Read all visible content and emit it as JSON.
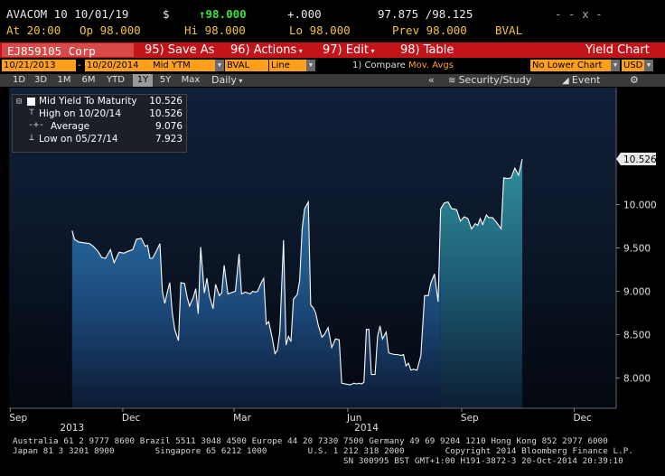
{
  "quote": {
    "security": "AVACOM 10 10/01/19",
    "currency_symbol": "$",
    "last": "98.000",
    "change": "+.000",
    "bid_ask": "97.875 /98.125",
    "window_controls": "- - x -",
    "at_label": "At",
    "at_value": "20:00",
    "open_label": "Op",
    "open_value": "98.000",
    "high_label": "Hi",
    "high_value": "98.000",
    "low_label": "Lo",
    "low_value": "98.000",
    "prev_label": "Prev",
    "prev_value": "98.000",
    "source": "BVAL"
  },
  "toolbar": {
    "ticker": "EJ859105 Corp",
    "save_label": "95) Save As",
    "actions_label": "96) Actions",
    "edit_label": "97) Edit",
    "table_label": "98) Table",
    "title": "Yield Chart"
  },
  "settings": {
    "start_date": "10/21/2013",
    "end_date": "10/20/2014",
    "field": "Mid YTM",
    "source": "BVAL",
    "style": "Line",
    "compare_label": "1) Compare",
    "mov_avgs": "Mov. Avgs",
    "lower_chart": "No Lower Chart",
    "currency": "USD"
  },
  "periods": {
    "items": [
      "1D",
      "3D",
      "1M",
      "6M",
      "YTD",
      "1Y",
      "5Y",
      "Max"
    ],
    "selected": "1Y",
    "frequency": "Daily",
    "security_study": "Security/Study",
    "event": "Event"
  },
  "legend": {
    "series": "Mid Yield To Maturity",
    "series_value": "10.526",
    "high_label": "High on 10/20/14",
    "high_value": "10.526",
    "avg_label": "Average",
    "avg_value": "9.076",
    "low_label": "Low on 05/27/14",
    "low_value": "7.923"
  },
  "chart_data": {
    "type": "area",
    "series": [
      {
        "name": "Mid Yield To Maturity",
        "x": [
          "2013-10-21",
          "2013-10-23",
          "2013-10-26",
          "2013-10-30",
          "2013-11-04",
          "2013-11-07",
          "2013-11-11",
          "2013-11-14",
          "2013-11-17",
          "2013-11-21",
          "2013-11-24",
          "2013-11-28",
          "2013-12-02",
          "2013-12-05",
          "2013-12-09",
          "2013-12-12",
          "2013-12-16",
          "2013-12-19",
          "2013-12-21",
          "2013-12-23",
          "2013-12-25",
          "2013-12-28",
          "2013-12-31",
          "2014-01-02",
          "2014-01-04",
          "2014-01-06",
          "2014-01-08",
          "2014-01-10",
          "2014-01-12",
          "2014-01-15",
          "2014-01-17",
          "2014-01-20",
          "2014-01-22",
          "2014-01-24",
          "2014-01-27",
          "2014-01-29",
          "2014-01-31",
          "2014-02-02",
          "2014-02-05",
          "2014-02-07",
          "2014-02-09",
          "2014-02-12",
          "2014-02-14",
          "2014-02-17",
          "2014-02-19",
          "2014-02-21",
          "2014-02-24",
          "2014-02-26",
          "2014-02-28",
          "2014-03-02",
          "2014-03-05",
          "2014-03-07",
          "2014-03-10",
          "2014-03-12",
          "2014-03-14",
          "2014-03-16",
          "2014-03-18",
          "2014-03-20",
          "2014-03-23",
          "2014-03-25",
          "2014-03-27",
          "2014-03-29",
          "2014-04-01",
          "2014-04-03",
          "2014-04-05",
          "2014-04-07",
          "2014-04-10",
          "2014-04-12",
          "2014-04-14",
          "2014-04-16",
          "2014-04-18",
          "2014-04-21",
          "2014-04-23",
          "2014-04-25",
          "2014-04-27",
          "2014-04-30",
          "2014-05-02",
          "2014-05-04",
          "2014-05-06",
          "2014-05-08",
          "2014-05-11",
          "2014-05-13",
          "2014-05-16",
          "2014-05-19",
          "2014-05-22",
          "2014-05-25",
          "2014-05-27",
          "2014-05-30",
          "2014-06-03",
          "2014-06-06",
          "2014-06-08",
          "2014-06-10",
          "2014-06-12",
          "2014-06-14",
          "2014-06-16",
          "2014-06-18",
          "2014-06-20",
          "2014-06-23",
          "2014-06-25",
          "2014-06-27",
          "2014-06-29",
          "2014-07-02",
          "2014-07-04",
          "2014-07-06",
          "2014-07-09",
          "2014-07-11",
          "2014-07-14",
          "2014-07-16",
          "2014-07-18",
          "2014-07-20",
          "2014-07-22",
          "2014-07-24",
          "2014-07-27",
          "2014-07-30",
          "2014-08-02",
          "2014-08-05",
          "2014-08-07",
          "2014-08-10",
          "2014-08-13",
          "2014-08-15",
          "2014-08-18",
          "2014-08-21",
          "2014-08-24",
          "2014-08-26",
          "2014-08-28",
          "2014-08-31",
          "2014-09-03",
          "2014-09-06",
          "2014-09-09",
          "2014-09-12",
          "2014-09-14",
          "2014-09-16",
          "2014-09-18",
          "2014-09-21",
          "2014-09-23",
          "2014-09-26",
          "2014-09-29",
          "2014-10-01",
          "2014-10-03",
          "2014-10-05",
          "2014-10-08",
          "2014-10-11",
          "2014-10-14",
          "2014-10-17",
          "2014-10-20"
        ],
        "y": [
          9.7,
          9.6,
          9.57,
          9.56,
          9.55,
          9.52,
          9.46,
          9.39,
          9.38,
          9.48,
          9.33,
          9.45,
          9.44,
          9.46,
          9.48,
          9.6,
          9.61,
          9.52,
          9.53,
          9.38,
          9.38,
          9.46,
          9.55,
          9.0,
          8.86,
          8.99,
          9.1,
          8.75,
          8.56,
          8.43,
          9.1,
          9.09,
          8.93,
          8.83,
          8.93,
          9.03,
          8.74,
          9.51,
          8.98,
          9.15,
          8.95,
          8.8,
          9.08,
          8.95,
          8.98,
          9.3,
          8.97,
          8.98,
          8.99,
          9.0,
          9.43,
          8.97,
          8.99,
          8.98,
          8.97,
          9.0,
          8.99,
          9.0,
          9.1,
          9.15,
          8.62,
          8.65,
          8.45,
          8.28,
          8.32,
          8.53,
          9.59,
          8.38,
          8.48,
          8.42,
          8.91,
          8.96,
          9.12,
          9.72,
          9.95,
          10.03,
          8.84,
          8.81,
          8.75,
          8.61,
          8.47,
          8.5,
          8.58,
          8.35,
          8.45,
          8.44,
          7.94,
          7.93,
          7.92,
          7.94,
          7.93,
          7.94,
          7.93,
          7.95,
          8.56,
          8.56,
          8.04,
          8.04,
          8.48,
          8.6,
          8.45,
          8.53,
          8.29,
          8.28,
          8.27,
          8.27,
          8.26,
          8.27,
          8.14,
          8.17,
          8.09,
          8.1,
          8.09,
          8.26,
          8.95,
          8.95,
          9.09,
          9.2,
          8.88,
          9.95,
          10.02,
          10.03,
          9.95,
          9.95,
          9.94,
          9.81,
          9.86,
          9.84,
          9.72,
          9.78,
          9.76,
          9.84,
          9.77,
          9.88,
          9.85,
          9.85,
          9.8,
          9.76,
          9.72,
          10.31,
          10.3,
          10.31,
          10.42,
          10.34,
          10.526
        ]
      }
    ],
    "x_ticks": [
      "Sep",
      "Dec",
      "Mar",
      "Jun",
      "Sep",
      "Dec"
    ],
    "x_years": [
      "2013",
      "2014"
    ],
    "y_ticks": [
      "8.000",
      "8.500",
      "9.000",
      "9.500",
      "10.000"
    ],
    "ylim": [
      7.65,
      11.35
    ],
    "last_value_label": "10.526",
    "legend_position": "top-left",
    "grid": false
  },
  "footer": {
    "line1": "Australia 61 2 9777 8600 Brazil 5511 3048 4500 Europe 44 20 7330 7500 Germany 49 69 9204 1210 Hong Kong 852 2977 6000",
    "line2": "Japan 81 3 3201 8900        Singapore 65 6212 1000        U.S. 1 212 318 2000        Copyright 2014 Bloomberg Finance L.P.",
    "line3": "SN 300995 BST  GMT+1:00 H191-3872-3 20-Oct-2014 20:39:10"
  },
  "colors": {
    "accent_red": "#c3141a",
    "amber": "#ff9f1a",
    "quote_yellow": "#f2c23a",
    "up_green": "#3be23b"
  }
}
